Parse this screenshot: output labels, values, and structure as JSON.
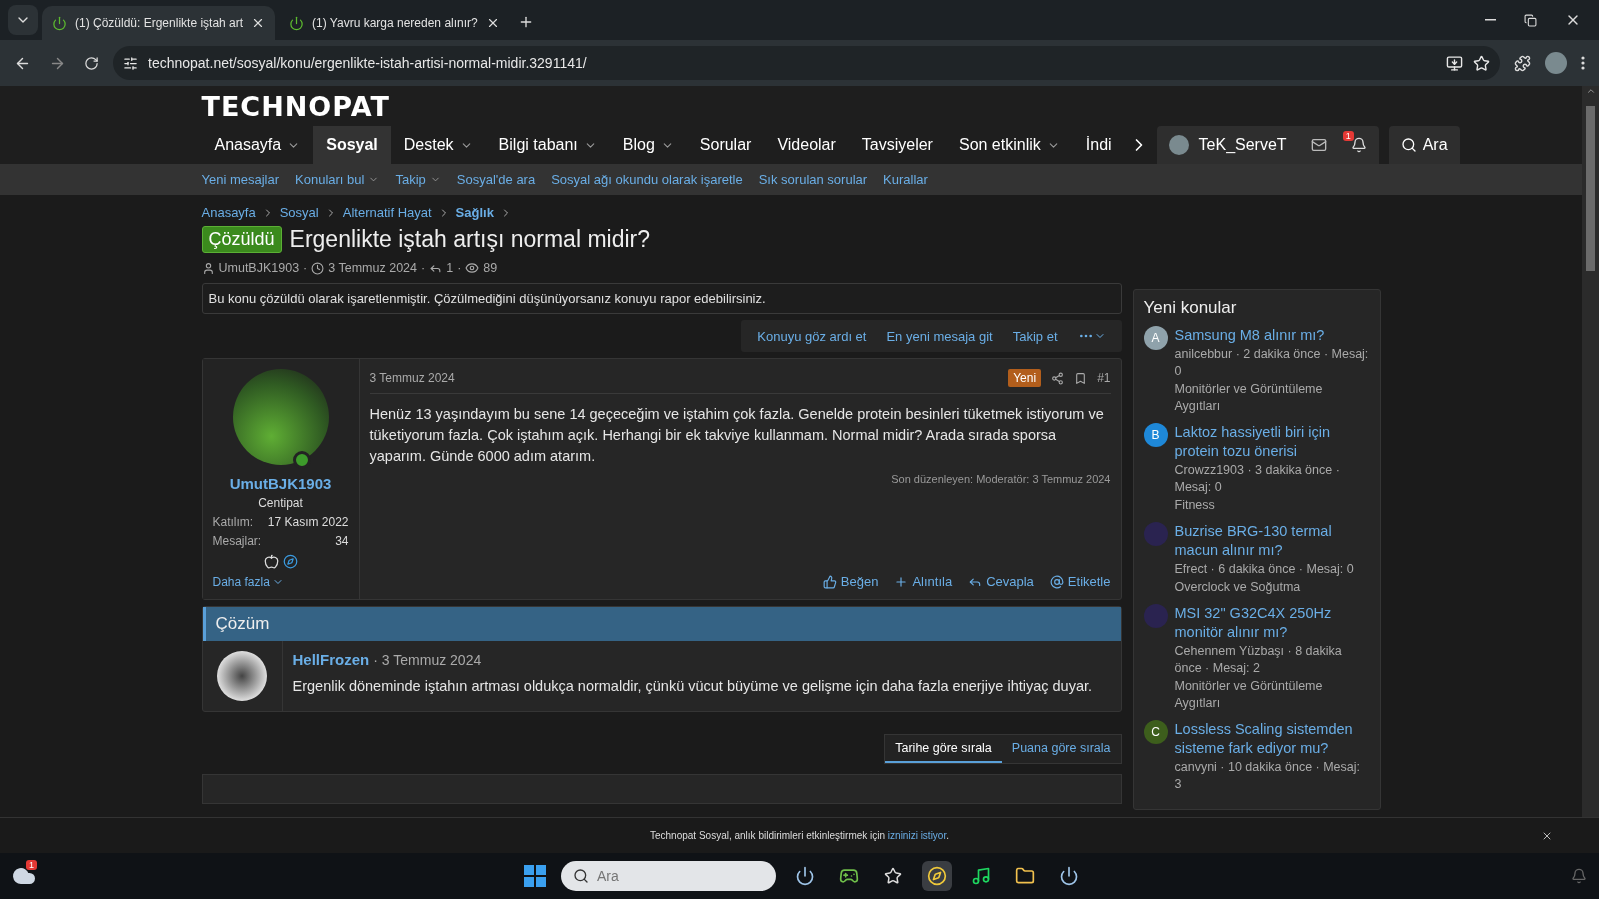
{
  "browser": {
    "tabs": [
      {
        "title": "(1) Çözüldü: Ergenlikte iştah art",
        "selected": true
      },
      {
        "title": "(1) Yavru karga nereden alınır?",
        "selected": false
      }
    ],
    "url": "technopat.net/sosyal/konu/ergenlikte-istah-artisi-normal-midir.3291141/"
  },
  "site": {
    "logo": "TECHNOPAT",
    "nav": [
      {
        "label": "Anasayfa",
        "selected": false,
        "dropdown": true
      },
      {
        "label": "Sosyal",
        "selected": true,
        "dropdown": false
      },
      {
        "label": "Destek",
        "selected": false,
        "dropdown": true
      },
      {
        "label": "Bilgi tabanı",
        "selected": false,
        "dropdown": true
      },
      {
        "label": "Blog",
        "selected": false,
        "dropdown": true
      },
      {
        "label": "Sorular",
        "selected": false,
        "dropdown": false
      },
      {
        "label": "Videolar",
        "selected": false,
        "dropdown": false
      },
      {
        "label": "Tavsiyeler",
        "selected": false,
        "dropdown": false
      },
      {
        "label": "Son etkinlik",
        "selected": false,
        "dropdown": true
      },
      {
        "label": "İndi",
        "selected": false,
        "dropdown": false
      }
    ],
    "user": "TeK_ServeT",
    "notification_count": "1",
    "search": "Ara",
    "subnav": [
      {
        "label": "Yeni mesajlar",
        "dropdown": false
      },
      {
        "label": "Konuları bul",
        "dropdown": true
      },
      {
        "label": "Takip",
        "dropdown": true
      },
      {
        "label": "Sosyal'de ara",
        "dropdown": false
      },
      {
        "label": "Sosyal ağı okundu olarak işaretle",
        "dropdown": false
      },
      {
        "label": "Sık sorulan sorular",
        "dropdown": false
      },
      {
        "label": "Kurallar",
        "dropdown": false
      }
    ]
  },
  "breadcrumbs": [
    {
      "label": "Anasayfa",
      "current": false
    },
    {
      "label": "Sosyal",
      "current": false
    },
    {
      "label": "Alternatif Hayat",
      "current": false
    },
    {
      "label": "Sağlık",
      "current": true
    }
  ],
  "thread": {
    "prefix": "Çözüldü",
    "title": "Ergenlikte iştah artışı normal midir?",
    "author": "UmutBJK1903",
    "date": "3 Temmuz 2024",
    "replies": "1",
    "views": "89",
    "separators": [
      "·",
      "·",
      "·"
    ],
    "notice": "Bu konu çözüldü olarak işaretlenmiştir. Çözülmediğini düşünüyorsanız konuyu rapor edebilirsiniz.",
    "actions": [
      "Konuyu göz ardı et",
      "En yeni mesaja git",
      "Takip et"
    ]
  },
  "post": {
    "user": {
      "name": "UmutBJK1903",
      "title": "Centipat",
      "online": true,
      "stats": [
        {
          "label": "Katılım:",
          "value": "17 Kasım 2022"
        },
        {
          "label": "Mesajlar:",
          "value": "34"
        }
      ],
      "more": "Daha fazla"
    },
    "date": "3 Temmuz 2024",
    "badge": "Yeni",
    "number": "#1",
    "body": "Henüz 13 yaşındayım bu sene 14 geçeceğim ve iştahim çok fazla. Genelde protein besinleri tüketmek istiyorum ve tüketiyorum fazla. Çok iştahım açık. Herhangi bir ek takviye kullanmam. Normal midir? Arada sırada sporsa yaparım. Günde 6000 adım atarım.",
    "edited": "Son düzenleyen: Moderatör: 3 Temmuz 2024",
    "actions": [
      {
        "kind": "like",
        "label": "Beğen"
      },
      {
        "kind": "quote",
        "label": "Alıntıla"
      },
      {
        "kind": "reply",
        "label": "Cevapla"
      },
      {
        "kind": "mention",
        "label": "Etiketle"
      }
    ]
  },
  "solution": {
    "heading": "Çözüm",
    "author": "HellFrozen",
    "separator": "·",
    "date": "3 Temmuz 2024",
    "text": "Ergenlik döneminde iştahın artması oldukça normaldir, çünkü vücut büyüme ve gelişme için daha fazla enerjiye ihtiyaç duyar."
  },
  "sort": [
    {
      "label": "Tarihe göre sırala",
      "selected": true
    },
    {
      "label": "Puana göre sırala",
      "selected": false
    }
  ],
  "sidebar": {
    "title": "Yeni konular",
    "items": [
      {
        "kind": "letter",
        "letter": "A",
        "color": "#8fa2ab",
        "title": "Samsung M8 alınır mı?",
        "meta": "anilcebbur · 2 dakika önce · Mesaj: 0",
        "forum": "Monitörler ve Görüntüleme Aygıtları"
      },
      {
        "kind": "letter",
        "letter": "B",
        "color": "#1e88d8",
        "title": "Laktoz hassiyetli biri için protein tozu önerisi",
        "meta": "Crowzz1903 · 3 dakika önce · Mesaj: 0",
        "forum": "Fitness"
      },
      {
        "kind": "image",
        "title": "Buzrise BRG-130 termal macun alınır mı?",
        "meta": "Efrect · 6 dakika önce · Mesaj: 0",
        "forum": "Overclock ve Soğutma"
      },
      {
        "kind": "image",
        "title": "MSI 32\" G32C4X 250Hz monitör alınır mı?",
        "meta": "Cehennem Yüzbaşı · 8 dakika önce · Mesaj: 2",
        "forum": "Monitörler ve Görüntüleme Aygıtları"
      },
      {
        "kind": "letter",
        "letter": "C",
        "color": "#3d5e1c",
        "title": "Lossless Scaling sistemden sisteme fark ediyor mu?",
        "meta": "canvyni · 10 dakika önce · Mesaj: 3"
      }
    ]
  },
  "notification": {
    "text": "Technopat Sosyal, anlık bildirimleri etkinleştirmek için ",
    "link": "izninizi istiyor",
    "end": "."
  },
  "taskbar": {
    "weather_badge": "1",
    "placeholder": "Ara"
  }
}
